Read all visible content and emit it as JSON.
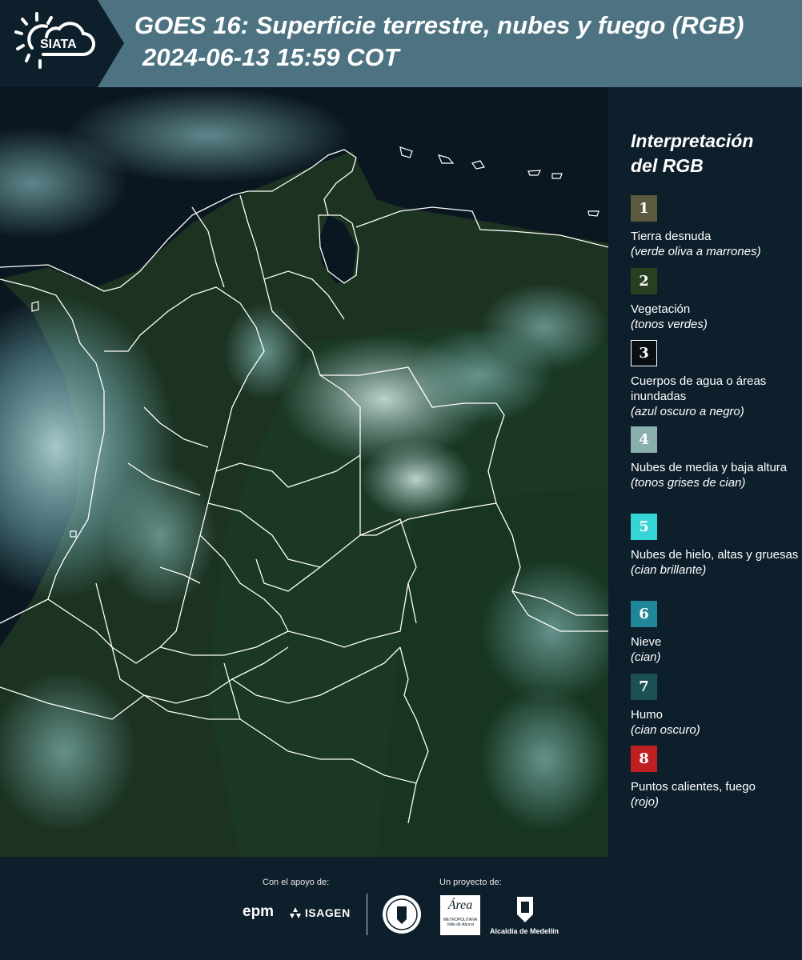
{
  "header": {
    "logo_text": "SIATA",
    "title_line1": "GOES 16: Superficie terrestre, nubes y fuego (RGB)",
    "title_line2": "2024-06-13 15:59 COT"
  },
  "legend": {
    "title_line1": "Interpretación",
    "title_line2": "del RGB",
    "items": [
      {
        "number": "1",
        "color": "#5b5a3f",
        "label": "Tierra desnuda",
        "desc": "(verde oliva a marrones)"
      },
      {
        "number": "2",
        "color": "#27401f",
        "label": "Vegetación",
        "desc": "(tonos verdes)"
      },
      {
        "number": "3",
        "color": "#0a0f14",
        "label": "Cuerpos de agua o áreas inundadas",
        "desc": "(azul oscuro a negro)"
      },
      {
        "number": "4",
        "color": "#89afac",
        "label": "Nubes de media y baja altura",
        "desc": "(tonos grises de cian)"
      },
      {
        "number": "5",
        "color": "#35d4d6",
        "label": "Nubes de hielo, altas y gruesas",
        "desc": "(cian brillante)"
      },
      {
        "number": "6",
        "color": "#1f8798",
        "label": "Nieve",
        "desc": "(cian)"
      },
      {
        "number": "7",
        "color": "#1d5055",
        "label": "Humo",
        "desc": "(cian oscuro)"
      },
      {
        "number": "8",
        "color": "#c01f22",
        "label": "Puntos calientes, fuego",
        "desc": "(rojo)"
      }
    ]
  },
  "footer": {
    "support_label": "Con el apoyo de:",
    "project_label": "Un proyecto de:",
    "epm_text": "epm",
    "isagen_text": "ISAGEN",
    "area_text": "Área",
    "area_sub1": "METROPOLITANA",
    "area_sub2": "Valle de Aburrá",
    "alcaldia_text": "Alcaldía de Medellín"
  }
}
